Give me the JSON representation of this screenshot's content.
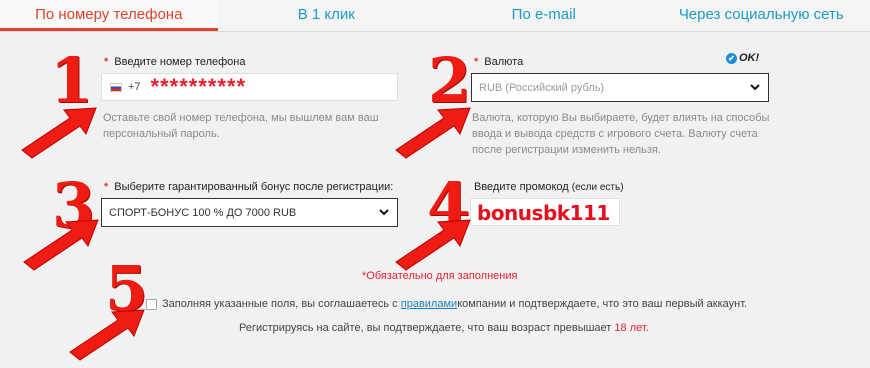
{
  "tabs": [
    {
      "label": "По номеру телефона",
      "active": true
    },
    {
      "label": "В 1 клик",
      "active": false
    },
    {
      "label": "По e-mail",
      "active": false
    },
    {
      "label": "Через социальную сеть",
      "active": false
    }
  ],
  "phone": {
    "label": "Введите номер телефона",
    "required_mark": "*",
    "country_code": "+7",
    "value": "**********",
    "hint_line1": "Оставьте свой номер телефона, мы вышлем вам ваш",
    "hint_line2": "персональный пароль."
  },
  "currency": {
    "label": "Валюта",
    "required_mark": "*",
    "ok_label": "OK!",
    "selected": "RUB (Российский рубль)",
    "hint_line1": "Валюта, которую Вы выбираете, будет влиять на способы",
    "hint_line2": "ввода и вывода средств с игрового счета. Валюту счета",
    "hint_line3": "после регистрации изменить нельзя."
  },
  "bonus": {
    "label": "Выберите гарантированный бонус после регистрации:",
    "required_mark": "*",
    "selected": "СПОРТ-БОНУС 100 % ДО 7000 RUB"
  },
  "promo": {
    "label": "Введите промокод",
    "label_note": "(если есть)",
    "value": "bonusbk111"
  },
  "required_note": "*Обязательно для заполнения",
  "agreement": {
    "text_before": "Заполняя указанные поля, вы соглашаетесь с ",
    "link_text": "правилами",
    "text_after": " компании и подтверждаете, что это ваш первый аккаунт."
  },
  "age_notice": {
    "text": "Регистрируясь на сайте, вы подтверждаете, что ваш возраст превышает ",
    "years": "18 лет."
  },
  "step_numbers": [
    "1",
    "2",
    "3",
    "4",
    "5"
  ],
  "colors": {
    "accent_red": "#e8202f",
    "link_blue": "#1c9bc6",
    "active_tab": "#d9452b"
  }
}
